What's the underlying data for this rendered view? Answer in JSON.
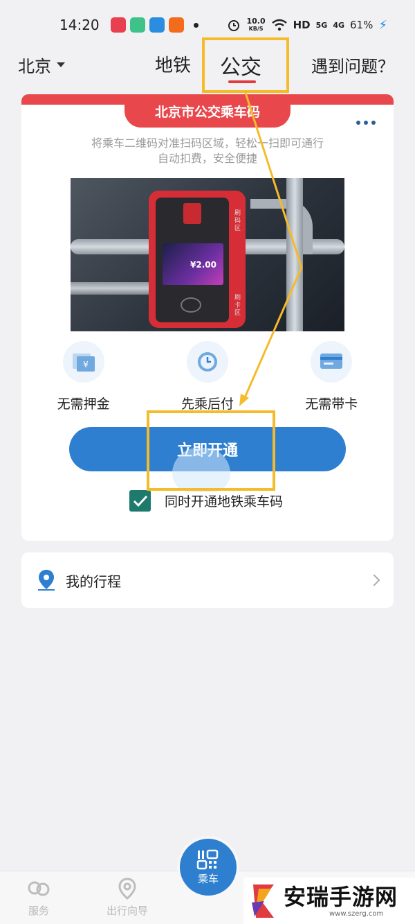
{
  "status_bar": {
    "time": "14:20",
    "net_speed_value": "10.0",
    "net_speed_unit": "KB/S",
    "hd": "HD",
    "signal1": "5G",
    "signal2": "4G",
    "battery": "61%",
    "icons": [
      "video-app-icon",
      "green-app-icon",
      "blue-app-icon",
      "taobao-app-icon",
      "alarm-icon",
      "wifi-icon",
      "battery-icon"
    ]
  },
  "top_nav": {
    "city": "北京",
    "tabs": [
      {
        "label": "地铁",
        "active": false
      },
      {
        "label": "公交",
        "active": true
      }
    ],
    "help": "遇到问题？"
  },
  "card": {
    "banner": "北京市公交乘车码",
    "desc_line1": "将乘车二维码对准扫码区域，轻松一扫即可通行",
    "desc_line2": "自动扣费，安全便捷",
    "photo": {
      "amount": "¥2.00",
      "scan_label": "刷码区",
      "card_label": "刷卡区"
    },
    "features": [
      {
        "label": "无需押金",
        "icon": "wallet-icon"
      },
      {
        "label": "先乘后付",
        "icon": "clock-icon"
      },
      {
        "label": "无需带卡",
        "icon": "card-icon"
      }
    ],
    "open_button": "立即开通",
    "checkbox_label": "同时开通地铁乘车码",
    "checkbox_checked": true
  },
  "trip": {
    "label": "我的行程"
  },
  "bottom_nav": {
    "services": "服务",
    "guide": "出行向导",
    "ride": "乘车"
  },
  "watermark": {
    "title": "安瑞手游网",
    "url": "www.szerg.com"
  },
  "colors": {
    "accent": "#2f7fd0",
    "brand_red": "#e8474b",
    "highlight": "#f4bb2a",
    "checkbox": "#1e7a6c"
  }
}
